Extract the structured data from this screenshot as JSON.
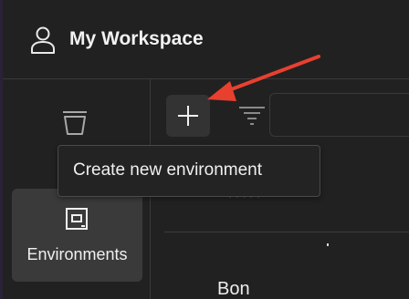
{
  "workspace": {
    "title": "My Workspace",
    "icon": "user-icon"
  },
  "sidebar": {
    "items": [
      {
        "label": "Collections",
        "visible_text": "Col",
        "icon": "trash-bin-icon",
        "active": false
      },
      {
        "label": "Environments",
        "icon": "environment-icon",
        "active": true
      }
    ]
  },
  "toolbar": {
    "add_icon": "plus-icon",
    "filter_icon": "filter-icon"
  },
  "tooltip": {
    "text": "Create new environment"
  },
  "list": {
    "partial_item_name": "Bon"
  },
  "colors": {
    "background": "#212121",
    "active_item": "#3a3a3a",
    "annotation_arrow": "#e8402f"
  }
}
